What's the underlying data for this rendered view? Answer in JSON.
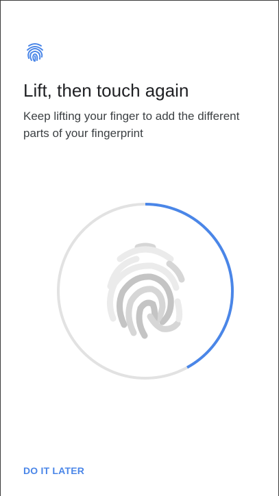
{
  "header": {
    "icon": "fingerprint-icon",
    "title": "Lift, then touch again",
    "subtitle": "Keep lifting your finger to add the different parts of your fingerprint"
  },
  "enrollment": {
    "progress": 0.42,
    "icon": "fingerprint-icon",
    "colors": {
      "track": "#e2e2e2",
      "progress": "#4a86e8",
      "print_light": "#ebebeb",
      "print_mid": "#d6d6d6",
      "print_dark": "#c4c4c4"
    }
  },
  "footer": {
    "do_later_label": "DO IT LATER"
  },
  "colors": {
    "accent": "#4a86e8",
    "title": "#202124",
    "subtitle": "#3c4043"
  }
}
